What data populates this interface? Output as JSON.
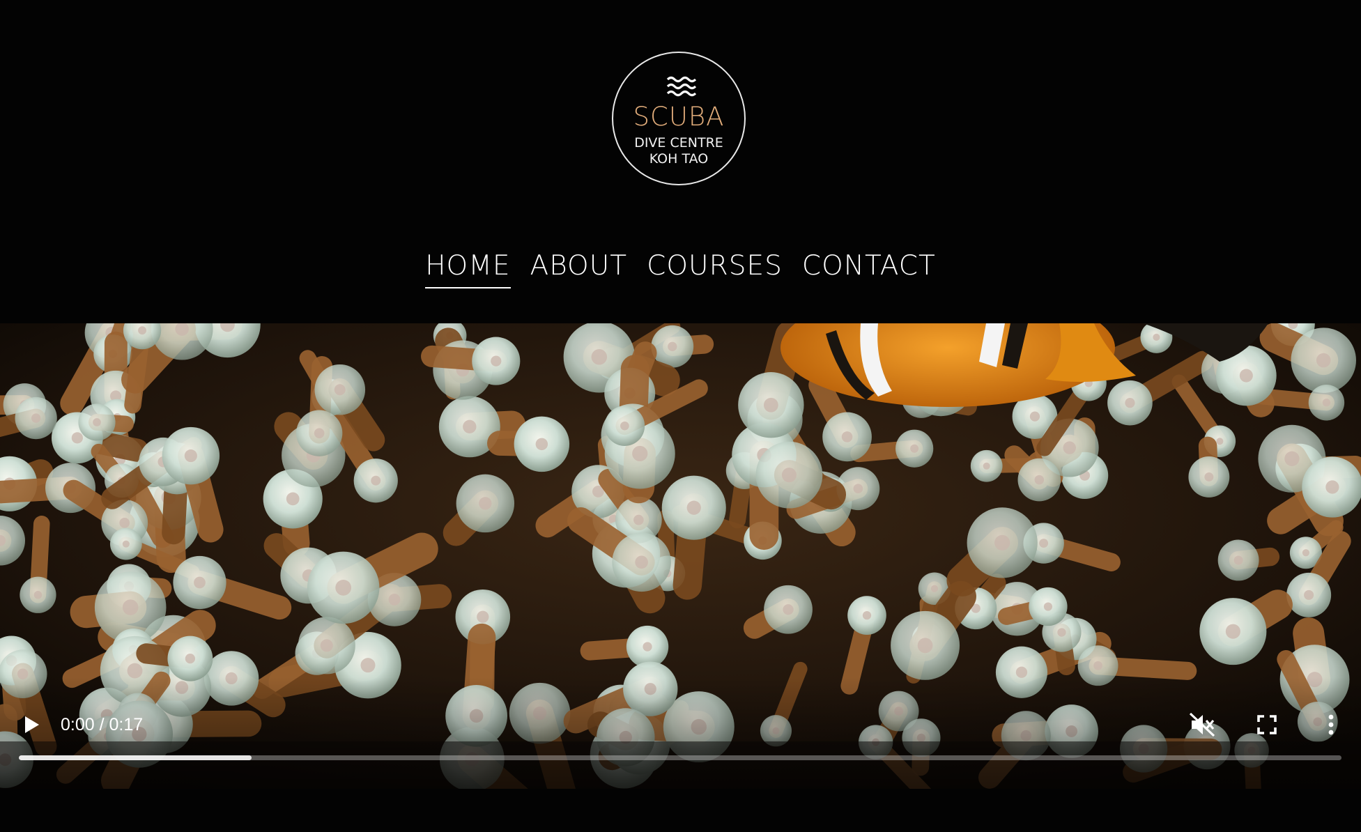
{
  "logo": {
    "brand": "SCUBA",
    "line1": "DIVE CENTRE",
    "line2": "KOH TAO",
    "icon": "waves-icon",
    "brand_color": "#e2ad7b"
  },
  "nav": {
    "items": [
      "HOME",
      "ABOUT",
      "COURSES",
      "CONTACT"
    ],
    "active": "HOME"
  },
  "video": {
    "time_display": "0:00 / 0:17",
    "buffered_fraction": 0.176,
    "icons": {
      "play": "play-icon",
      "mute": "muted-speaker-icon",
      "fullscreen": "fullscreen-icon",
      "more": "more-vertical-icon"
    }
  }
}
